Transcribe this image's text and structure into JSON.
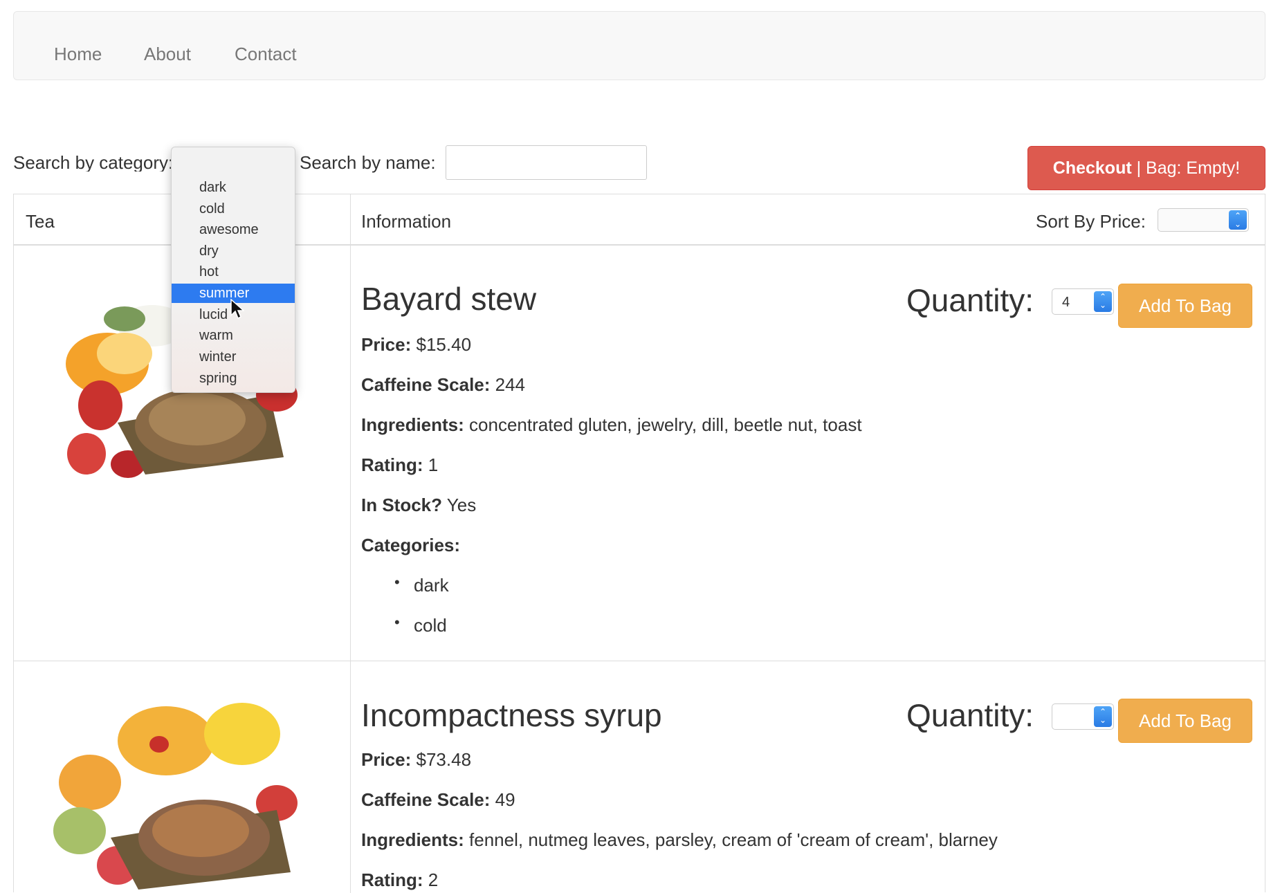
{
  "nav": {
    "items": [
      "Home",
      "About",
      "Contact"
    ]
  },
  "search": {
    "category_label": "Search by category:",
    "name_label": "Search by name:",
    "name_placeholder": "",
    "category_options": [
      "dark",
      "cold",
      "awesome",
      "dry",
      "hot",
      "summer",
      "lucid",
      "warm",
      "winter",
      "spring"
    ],
    "category_highlighted": "summer"
  },
  "checkout": {
    "label_bold": "Checkout",
    "label_rest": " | Bag: Empty!"
  },
  "table": {
    "headers": [
      "Tea",
      "Information"
    ],
    "sort_label": "Sort By Price:"
  },
  "products": [
    {
      "name": "Bayard stew",
      "price_label": "Price:",
      "price": "$15.40",
      "caffeine_label": "Caffeine Scale:",
      "caffeine": "244",
      "ingredients_label": "Ingredients:",
      "ingredients": "concentrated gluten, jewelry, dill, beetle nut, toast",
      "rating_label": "Rating:",
      "rating": "1",
      "stock_label": "In Stock?",
      "stock": "Yes",
      "categories_label": "Categories:",
      "categories": [
        "dark",
        "cold"
      ],
      "quantity_label": "Quantity:",
      "quantity": "4",
      "add_label": "Add To Bag"
    },
    {
      "name": "Incompactness syrup",
      "price_label": "Price:",
      "price": "$73.48",
      "caffeine_label": "Caffeine Scale:",
      "caffeine": "49",
      "ingredients_label": "Ingredients:",
      "ingredients": "fennel, nutmeg leaves, parsley, cream of 'cream of cream', blarney",
      "rating_label": "Rating:",
      "rating": "2",
      "quantity_label": "Quantity:",
      "quantity": "",
      "add_label": "Add To Bag"
    }
  ],
  "colors": {
    "checkout": "#dd5a4f",
    "add_to_bag": "#f0ad4e",
    "dropdown_highlight": "#2d7bf0"
  }
}
